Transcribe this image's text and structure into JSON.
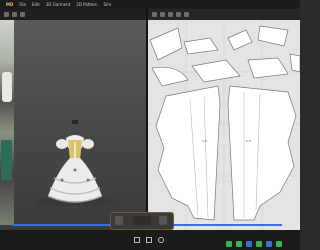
{
  "menu": {
    "logo": "MD",
    "items": [
      "File",
      "Edit",
      "3D Garment",
      "2D Pattern",
      "Sim"
    ]
  },
  "view3d": {
    "name": "3D Garment window"
  },
  "view2d": {
    "name": "2D Pattern window"
  },
  "pattern": {
    "annotations": [
      "0,8",
      "0,8"
    ]
  },
  "playback": {
    "left_icon": "ruler-icon",
    "right_icon": "settings-icon"
  },
  "dock": {
    "icons": [
      "pin-icon",
      "grid-icon",
      "record-icon"
    ]
  },
  "colors": {
    "accent": "#3a6fd8",
    "pattern_bg": "#e4e4e4",
    "dress": "#ececec",
    "bodice_accent": "#d9c36a"
  }
}
